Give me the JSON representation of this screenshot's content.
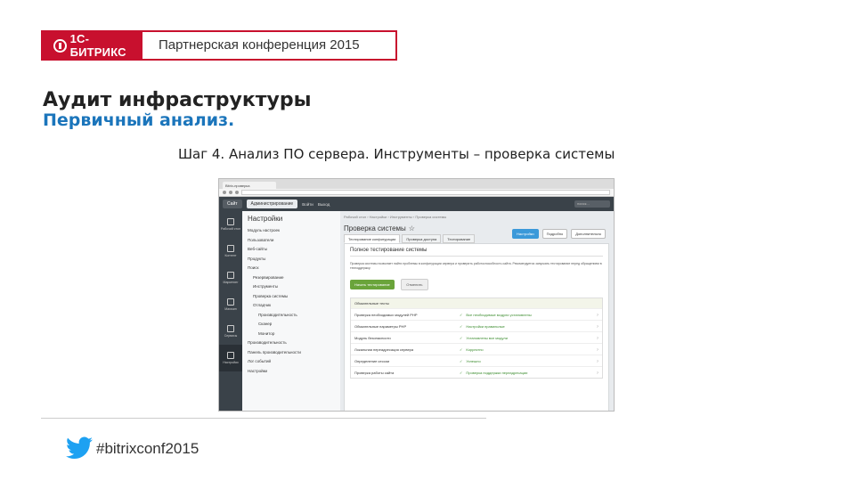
{
  "header": {
    "logo_text": "1С-БИТРИКС",
    "conference": "Партнерская конференция 2015"
  },
  "title": {
    "line1": "Аудит инфраструктуры",
    "line2": "Первичный анализ.",
    "step": "Шаг 4. Анализ ПО сервера. Инструменты – проверка системы"
  },
  "footer": {
    "hashtag": "#bitrixconf2015"
  },
  "colors": {
    "brand_red": "#c8102e",
    "accent_blue": "#1b75bb"
  },
  "screenshot": {
    "browser_tab": "Bitrix-проверка",
    "admin_bar": {
      "site": "Сайт",
      "admin": "Администрирование",
      "items": [
        "Войти",
        "Выход"
      ],
      "search": "поиск..."
    },
    "rail": [
      "Рабочий стол",
      "Контент",
      "Маркетинг",
      "Магазин",
      "Сервисы",
      "Аналитика",
      "Настройки"
    ],
    "tree_title": "Настройки",
    "tree_items": [
      "Модуль настроек",
      "Пользователи",
      "Веб-сайты",
      "Продукты",
      "Поиск",
      "Резервирование",
      "Инструменты",
      "Проверка системы",
      "Отладчик",
      "Производительность",
      "Сканер",
      "Монитор",
      "Производительность",
      "Панель производительности",
      "Лог событий",
      "Настройки"
    ],
    "breadcrumbs": "Рабочий стол › Настройки › Инструменты › Проверка системы",
    "page_title": "Проверка системы",
    "header_buttons": [
      "Настройки",
      "Подробно",
      "Дополнительно"
    ],
    "tabs": [
      "Тестирование конфигурации",
      "Проверка доступа",
      "Тестирование"
    ],
    "panel_title": "Полное тестирование системы",
    "panel_desc": "Проверка системы позволяет найти проблемы в конфигурации сервера и проверить работоспособность сайта. Рекомендуется запускать тестирование перед обращением в техподдержку.",
    "run_button": "Начать тестирование",
    "second_button": "Отменить",
    "results_header": "Обязательные тесты",
    "results": [
      {
        "name": "Проверка необходимых модулей PHP",
        "value": "Все необходимые модули установлены"
      },
      {
        "name": "Обязательные параметры PHP",
        "value": "Настройки правильные"
      },
      {
        "name": "Модуль безопасности",
        "value": "Установлены все модули"
      },
      {
        "name": "Локальная переадресация сервера",
        "value": "Корректно"
      },
      {
        "name": "Определение сессии",
        "value": "Успешно"
      },
      {
        "name": "Проверка работы сайта",
        "value": "Проверка поддержки переадресации"
      }
    ]
  }
}
